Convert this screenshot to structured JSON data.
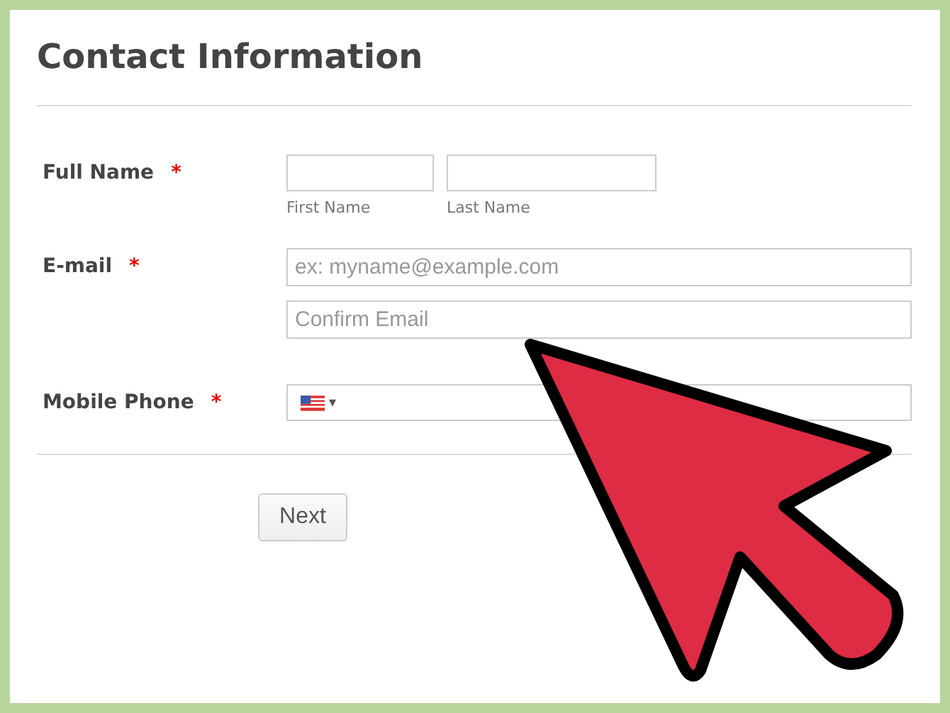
{
  "title": "Contact Information",
  "full_name": {
    "label": "Full Name",
    "required_mark": "*",
    "first_caption": "First Name",
    "last_caption": "Last Name"
  },
  "email": {
    "label": "E-mail",
    "required_mark": "*",
    "placeholder": "ex: myname@example.com",
    "confirm_placeholder": "Confirm Email"
  },
  "mobile_phone": {
    "label": "Mobile Phone",
    "required_mark": "*",
    "dropdown_caret": "▾"
  },
  "next_button": "Next"
}
